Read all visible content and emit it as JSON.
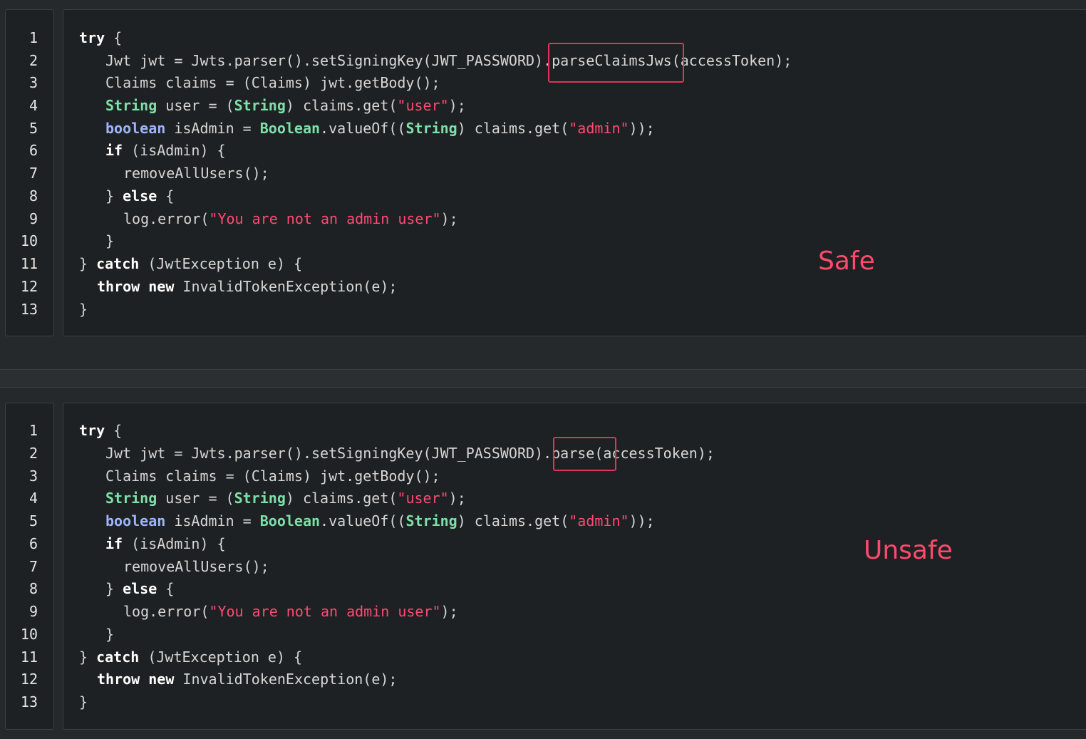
{
  "snippets": [
    {
      "label": "Safe",
      "method_call": ".parseClaimsJws",
      "lines": [
        {
          "n": "1"
        },
        {
          "n": "2"
        },
        {
          "n": "3"
        },
        {
          "n": "4"
        },
        {
          "n": "5"
        },
        {
          "n": "6"
        },
        {
          "n": "7"
        },
        {
          "n": "8"
        },
        {
          "n": "9"
        },
        {
          "n": "10"
        },
        {
          "n": "11"
        },
        {
          "n": "12"
        },
        {
          "n": "13"
        }
      ]
    },
    {
      "label": "Unsafe",
      "method_call": ".parse",
      "lines": [
        {
          "n": "1"
        },
        {
          "n": "2"
        },
        {
          "n": "3"
        },
        {
          "n": "4"
        },
        {
          "n": "5"
        },
        {
          "n": "6"
        },
        {
          "n": "7"
        },
        {
          "n": "8"
        },
        {
          "n": "9"
        },
        {
          "n": "10"
        },
        {
          "n": "11"
        },
        {
          "n": "12"
        },
        {
          "n": "13"
        }
      ]
    }
  ],
  "code": {
    "try": "try",
    "brace_open": " {",
    "jwt_line_prefix": "Jwt jwt = Jwts.parser().setSigningKey(JWT_PASSWORD)",
    "jwt_line_suffix": "(accessToken);",
    "claims_line": "Claims claims = (Claims) jwt.getBody();",
    "string_kw": "String",
    "user_mid": " user = (",
    "user_mid2": ") claims.get(",
    "user_str": "\"user\"",
    "line_end": ");",
    "boolean_kw": "boolean",
    "isadmin_mid": " isAdmin = ",
    "boolean_cls": "Boolean",
    "valueof": ".valueOf((",
    "claims_get": ") claims.get(",
    "admin_str": "\"admin\"",
    "line_end2": "));",
    "if_kw": "if",
    "if_rest": " (isAdmin) {",
    "remove_line": "removeAllUsers();",
    "close_brace": "}",
    "else_kw": "else",
    "log_prefix": "log.error(",
    "log_str": "\"You are not an admin user\"",
    "catch_kw": "catch",
    "catch_rest": " (JwtException e) {",
    "throw_kw": "throw",
    "new_kw": "new",
    "throw_rest": " InvalidTokenException(e);"
  }
}
